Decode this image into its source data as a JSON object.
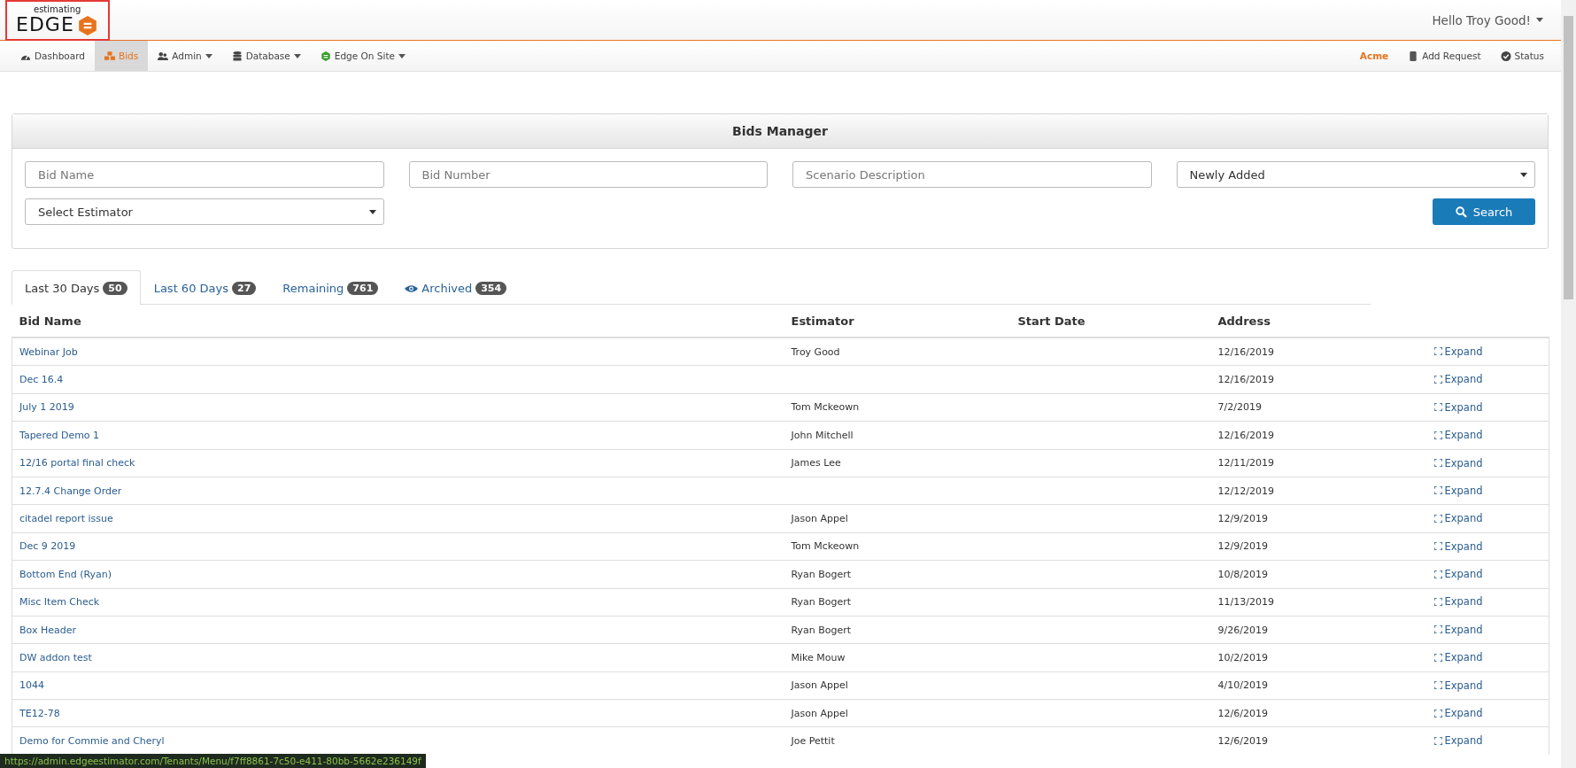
{
  "logo": {
    "top": "estimating",
    "word": "EDGE"
  },
  "user_menu": {
    "label": "Hello Troy Good!"
  },
  "nav": {
    "left": [
      {
        "label": "Dashboard",
        "kind": "dashboard",
        "dropdown": false,
        "selected": false
      },
      {
        "label": "Bids",
        "kind": "bids",
        "dropdown": false,
        "selected": true
      },
      {
        "label": "Admin",
        "kind": "admin",
        "dropdown": true,
        "selected": false
      },
      {
        "label": "Database",
        "kind": "database",
        "dropdown": true,
        "selected": false
      },
      {
        "label": "Edge On Site",
        "kind": "onsite",
        "dropdown": true,
        "selected": false
      }
    ],
    "right": [
      {
        "label": "Acme",
        "kind": "tenant",
        "highlight": true
      },
      {
        "label": "Add Request",
        "kind": "request",
        "highlight": false
      },
      {
        "label": "Status",
        "kind": "status",
        "highlight": false
      }
    ]
  },
  "panel": {
    "title": "Bids Manager",
    "fields": [
      {
        "kind": "input",
        "placeholder": "Bid Name"
      },
      {
        "kind": "input",
        "placeholder": "Bid Number"
      },
      {
        "kind": "input",
        "placeholder": "Scenario Description"
      },
      {
        "kind": "select",
        "value": "Newly Added"
      },
      {
        "kind": "select",
        "value": "Select Estimator"
      }
    ],
    "search_button": "Search"
  },
  "tabs": [
    {
      "label": "Last 30 Days",
      "count": "50",
      "kind": "recent",
      "selected": true
    },
    {
      "label": "Last 60 Days",
      "count": "27",
      "kind": "recent",
      "selected": false
    },
    {
      "label": "Remaining",
      "count": "761",
      "kind": "recent",
      "selected": false
    },
    {
      "label": "Archived",
      "count": "354",
      "kind": "archive",
      "selected": false
    }
  ],
  "table": {
    "columns": [
      "Bid Name",
      "Estimator",
      "Start Date",
      "Address"
    ],
    "rows": [
      {
        "bid_name": "Webinar Job",
        "estimator": "Troy Good",
        "address": "12/16/2019",
        "action": "Expand"
      },
      {
        "bid_name": "Dec 16.4",
        "estimator": "",
        "address": "12/16/2019",
        "action": "Expand"
      },
      {
        "bid_name": "July 1 2019",
        "estimator": "Tom Mckeown",
        "address": "7/2/2019",
        "action": "Expand"
      },
      {
        "bid_name": "Tapered Demo 1",
        "estimator": "John Mitchell",
        "address": "12/16/2019",
        "action": "Expand"
      },
      {
        "bid_name": "12/16 portal final check",
        "estimator": "James Lee",
        "address": "12/11/2019",
        "action": "Expand"
      },
      {
        "bid_name": "12.7.4 Change Order",
        "estimator": "",
        "address": "12/12/2019",
        "action": "Expand"
      },
      {
        "bid_name": "citadel report issue",
        "estimator": "Jason Appel",
        "address": "12/9/2019",
        "action": "Expand"
      },
      {
        "bid_name": "Dec 9 2019",
        "estimator": "Tom Mckeown",
        "address": "12/9/2019",
        "action": "Expand"
      },
      {
        "bid_name": "Bottom End (Ryan)",
        "estimator": "Ryan Bogert",
        "address": "10/8/2019",
        "action": "Expand"
      },
      {
        "bid_name": "Misc Item Check",
        "estimator": "Ryan Bogert",
        "address": "11/13/2019",
        "action": "Expand"
      },
      {
        "bid_name": "Box Header",
        "estimator": "Ryan Bogert",
        "address": "9/26/2019",
        "action": "Expand"
      },
      {
        "bid_name": "DW addon test",
        "estimator": "Mike Mouw",
        "address": "10/2/2019",
        "action": "Expand"
      },
      {
        "bid_name": "1044",
        "estimator": "Jason Appel",
        "address": "4/10/2019",
        "action": "Expand"
      },
      {
        "bid_name": "TE12-78",
        "estimator": "Jason Appel",
        "address": "12/6/2019",
        "action": "Expand"
      },
      {
        "bid_name": "Demo for Commie and Cheryl",
        "estimator": "Joe Pettit",
        "address": "12/6/2019",
        "action": "Expand"
      }
    ]
  },
  "status_url": "https://admin.edgeestimator.com/Tenants/Menu/f7ff8861-7c50-e411-80bb-5662e236149f"
}
